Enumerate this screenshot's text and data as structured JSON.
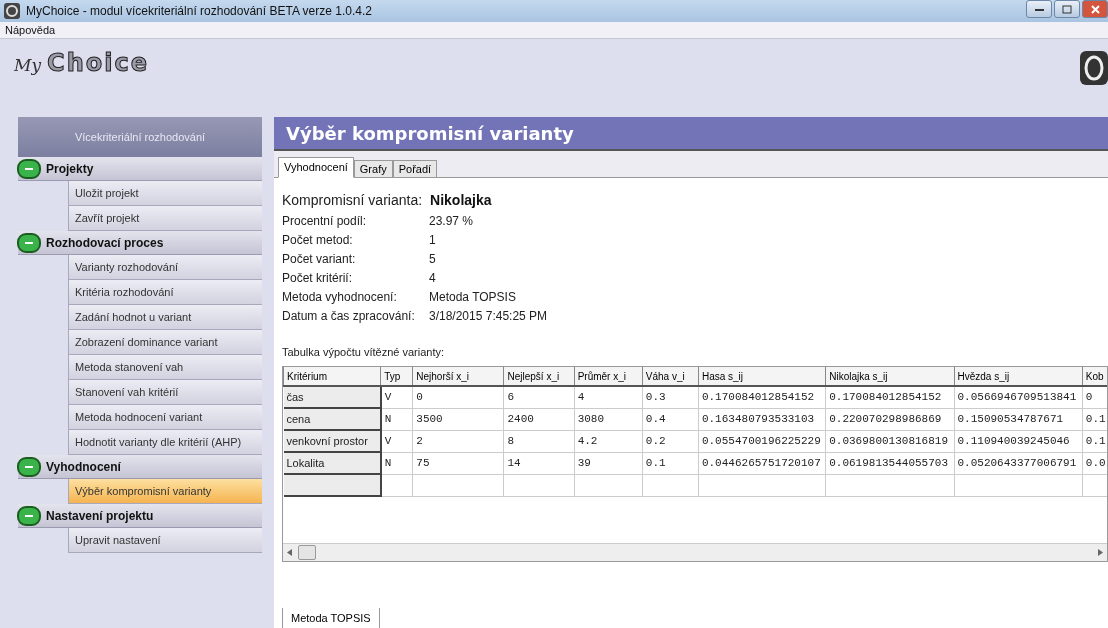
{
  "window": {
    "title": "MyChoice - modul vícekriteriální rozhodování BETA verze 1.0.4.2"
  },
  "menu": [
    "Nápověda"
  ],
  "logo": {
    "prefix": "My",
    "name": "Choice"
  },
  "sidebar": {
    "header": "Vícekriteriální rozhodování",
    "groups": [
      {
        "label": "Projekty",
        "expanded": true,
        "items": [
          {
            "label": "Uložit projekt",
            "selected": false
          },
          {
            "label": "Zavřít projekt",
            "selected": false
          }
        ]
      },
      {
        "label": "Rozhodovací proces",
        "expanded": true,
        "items": [
          {
            "label": "Varianty rozhodování",
            "selected": false
          },
          {
            "label": "Kritéria rozhodování",
            "selected": false
          },
          {
            "label": "Zadání hodnot u variant",
            "selected": false
          },
          {
            "label": "Zobrazení dominance variant",
            "selected": false
          },
          {
            "label": "Metoda stanovení vah",
            "selected": false
          },
          {
            "label": "Stanovení vah kritérií",
            "selected": false
          },
          {
            "label": "Metoda hodnocení variant",
            "selected": false
          },
          {
            "label": "Hodnotit varianty dle kritérií (AHP)",
            "selected": false
          }
        ]
      },
      {
        "label": "Vyhodnocení",
        "expanded": true,
        "items": [
          {
            "label": "Výběr kompromisní varianty",
            "selected": true
          }
        ]
      },
      {
        "label": "Nastavení projektu",
        "expanded": true,
        "items": [
          {
            "label": "Upravit nastavení",
            "selected": false
          }
        ]
      }
    ]
  },
  "panel": {
    "title": "Výběr kompromisní varianty",
    "tabs": [
      {
        "label": "Vyhodnocení",
        "selected": true
      },
      {
        "label": "Grafy",
        "selected": false
      },
      {
        "label": "Pořadí",
        "selected": false
      }
    ],
    "result": {
      "label": "Kompromisní varianta:",
      "value": "Nikolajka"
    },
    "facts": [
      {
        "label": "Procentní podíl:",
        "value": "23.97 %"
      },
      {
        "label": "Počet metod:",
        "value": "1"
      },
      {
        "label": "Počet variant:",
        "value": "5"
      },
      {
        "label": "Počet kritérií:",
        "value": "4"
      },
      {
        "label": "Metoda vyhodnocení:",
        "value": "Metoda TOPSIS"
      },
      {
        "label": "Datum a čas zpracování:",
        "value": "3/18/2015 7:45:25 PM"
      }
    ],
    "table_caption": "Tabulka výpočtu vítězné varianty:",
    "table": {
      "columns": [
        "Kritérium",
        "Typ",
        "Nejhorší x_i",
        "Nejlepší x_i",
        "Průměr x_i",
        "Váha v_i",
        "Hasa s_ij",
        "Nikolajka s_ij",
        "Hvězda s_ij",
        "Kob"
      ],
      "rows": [
        [
          "čas",
          "V",
          "0",
          "6",
          "4",
          "0.3",
          "0.170084012854152",
          "0.170084012854152",
          "0.0566946709513841",
          "0"
        ],
        [
          "cena",
          "N",
          "3500",
          "2400",
          "3080",
          "0.4",
          "0.163480793533103",
          "0.220070298986869",
          "0.15090534787671",
          "0.1"
        ],
        [
          "venkovní prostor",
          "V",
          "2",
          "8",
          "4.2",
          "0.2",
          "0.0554700196225229",
          "0.0369800130816819",
          "0.110940039245046",
          "0.1"
        ],
        [
          "Lokalita",
          "N",
          "75",
          "14",
          "39",
          "0.1",
          "0.0446265751720107",
          "0.0619813544055703",
          "0.0520643377006791",
          "0.0"
        ]
      ]
    },
    "bottom_tabs": [
      {
        "label": "Metoda TOPSIS",
        "selected": true
      }
    ]
  }
}
